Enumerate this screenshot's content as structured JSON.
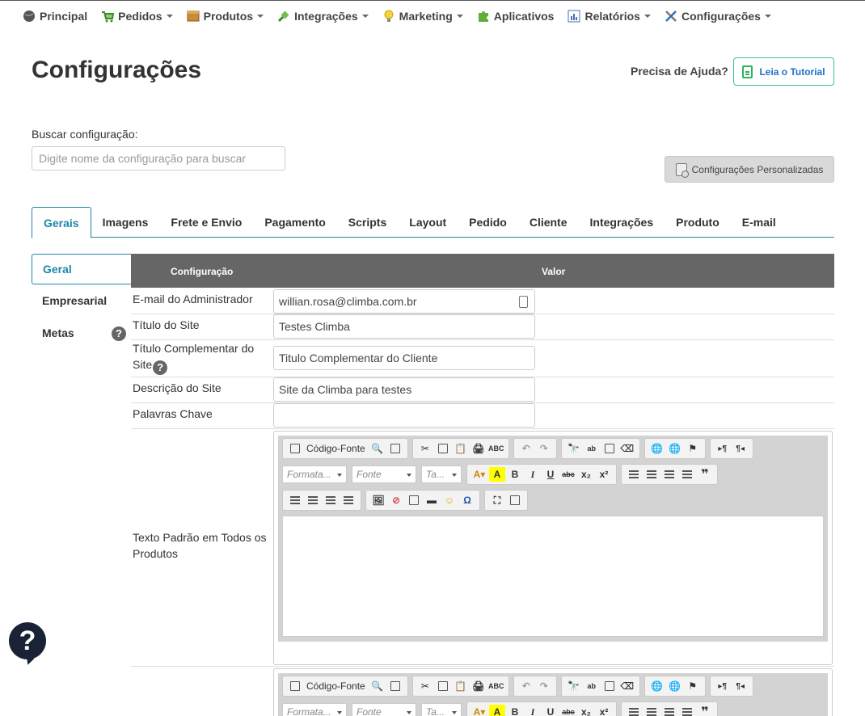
{
  "nav": {
    "items": [
      {
        "label": "Principal",
        "icon": "globe-icon",
        "caret": false
      },
      {
        "label": "Pedidos",
        "icon": "cart-icon",
        "caret": true
      },
      {
        "label": "Produtos",
        "icon": "box-icon",
        "caret": true
      },
      {
        "label": "Integrações",
        "icon": "plug-icon",
        "caret": true
      },
      {
        "label": "Marketing",
        "icon": "lightbulb-icon",
        "caret": true
      },
      {
        "label": "Aplicativos",
        "icon": "puzzle-icon",
        "caret": false
      },
      {
        "label": "Relatórios",
        "icon": "report-icon",
        "caret": true
      },
      {
        "label": "Configurações",
        "icon": "tools-icon",
        "caret": true
      }
    ]
  },
  "page": {
    "title": "Configurações",
    "help_text": "Precisa de Ajuda?",
    "tutorial_label": "Leia o Tutorial",
    "search_label": "Buscar configuração:",
    "search_placeholder": "Digite nome da configuração para buscar",
    "custom_label": "Configurações Personalizadas"
  },
  "tabs": [
    "Gerais",
    "Imagens",
    "Frete e Envio",
    "Pagamento",
    "Scripts",
    "Layout",
    "Pedido",
    "Cliente",
    "Integrações",
    "Produto",
    "E-mail"
  ],
  "side_menu": [
    "Geral",
    "Empresarial",
    "Metas"
  ],
  "table": {
    "col_config": "Configuração",
    "col_value": "Valor",
    "rows": [
      {
        "label": "E-mail do Administrador",
        "value": "willian.rosa@climba.com.br"
      },
      {
        "label": "Título do Site",
        "value": "Testes Climba"
      },
      {
        "label": "Título Complementar do Site",
        "value": "Titulo Complementar do Cliente"
      },
      {
        "label": "Descrição do Site",
        "value": "Site da Climba para testes"
      },
      {
        "label": "Palavras Chave",
        "value": ""
      },
      {
        "label": "Texto Padrão em Todos os Produtos",
        "value": ""
      }
    ]
  },
  "editor": {
    "source_label": "Código-Fonte",
    "format_placeholder": "Formata...",
    "font_placeholder": "Fonte",
    "size_placeholder": "Ta..."
  },
  "help_float_symbol": "?",
  "colors": {
    "accent": "#1e87a8",
    "header": "#666666",
    "tutorial_border": "#3bbfa3"
  }
}
